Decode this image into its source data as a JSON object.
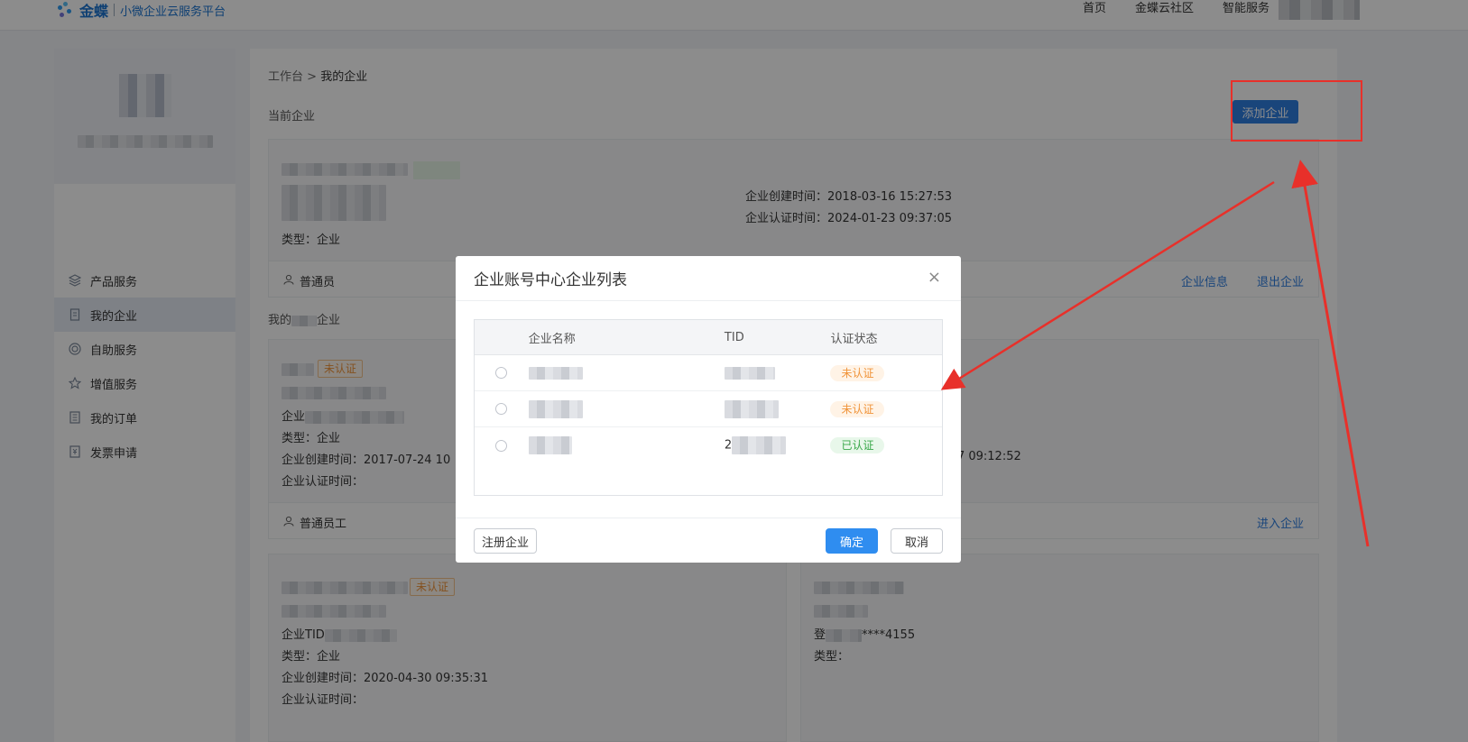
{
  "topbar": {
    "brand": "金蝶",
    "subtitle": "小微企业云服务平台",
    "nav": [
      "首页",
      "金蝶云社区",
      "智能服务"
    ]
  },
  "sidebar": {
    "items": [
      {
        "label": "产品服务",
        "icon": "layers-icon"
      },
      {
        "label": "我的企业",
        "icon": "document-icon",
        "active": true
      },
      {
        "label": "自助服务",
        "icon": "target-icon"
      },
      {
        "label": "增值服务",
        "icon": "star-icon"
      },
      {
        "label": "我的订单",
        "icon": "list-icon"
      },
      {
        "label": "发票申请",
        "icon": "invoice-icon"
      }
    ]
  },
  "main": {
    "breadcrumb_root": "工作台",
    "breadcrumb_sep": ">",
    "breadcrumb_current": "我的企业",
    "current_section": "当前企业",
    "add_button": "添加企业",
    "my_section": "我的",
    "my_section_suffix": "企业",
    "current_card": {
      "type_label": "类型：企业",
      "created": "企业创建时间：2018-03-16 15:27:53",
      "certified": "企业认证时间：2024-01-23 09:37:05",
      "role": "普通员",
      "link_info": "企业信息",
      "link_exit": "退出企业"
    },
    "card2": {
      "badge": "未认证",
      "tid_label": "企业",
      "type_label": "类型：企业",
      "created": "企业创建时间：2017-07-24 10",
      "certified": "企业认证时间：",
      "right_created": "-27 09:12:52",
      "role": "普通员工",
      "link_enter": "进入企业"
    },
    "card3": {
      "badge": "未认证",
      "tid_label": "企业TID",
      "type_label": "类型：企业",
      "created": "企业创建时间：2020-04-30 09:35:31",
      "certified": "企业认证时间："
    },
    "card4": {
      "login_label": "登",
      "login_mask": "****4155",
      "type_label": "类型："
    }
  },
  "modal": {
    "title": "企业账号中心企业列表",
    "close": "×",
    "columns": [
      "企业名称",
      "TID",
      "认证状态"
    ],
    "rows": [
      {
        "status": "未认证",
        "status_kind": "warn"
      },
      {
        "status": "未认证",
        "status_kind": "warn"
      },
      {
        "status": "已认证",
        "status_kind": "ok",
        "tid_prefix": "2"
      }
    ],
    "register_button": "注册企业",
    "confirm_button": "确定",
    "cancel_button": "取消"
  },
  "colors": {
    "accent": "#2f7ee0",
    "annotation": "#e8302a",
    "warn": "#f0943a",
    "ok": "#3aa84a"
  }
}
